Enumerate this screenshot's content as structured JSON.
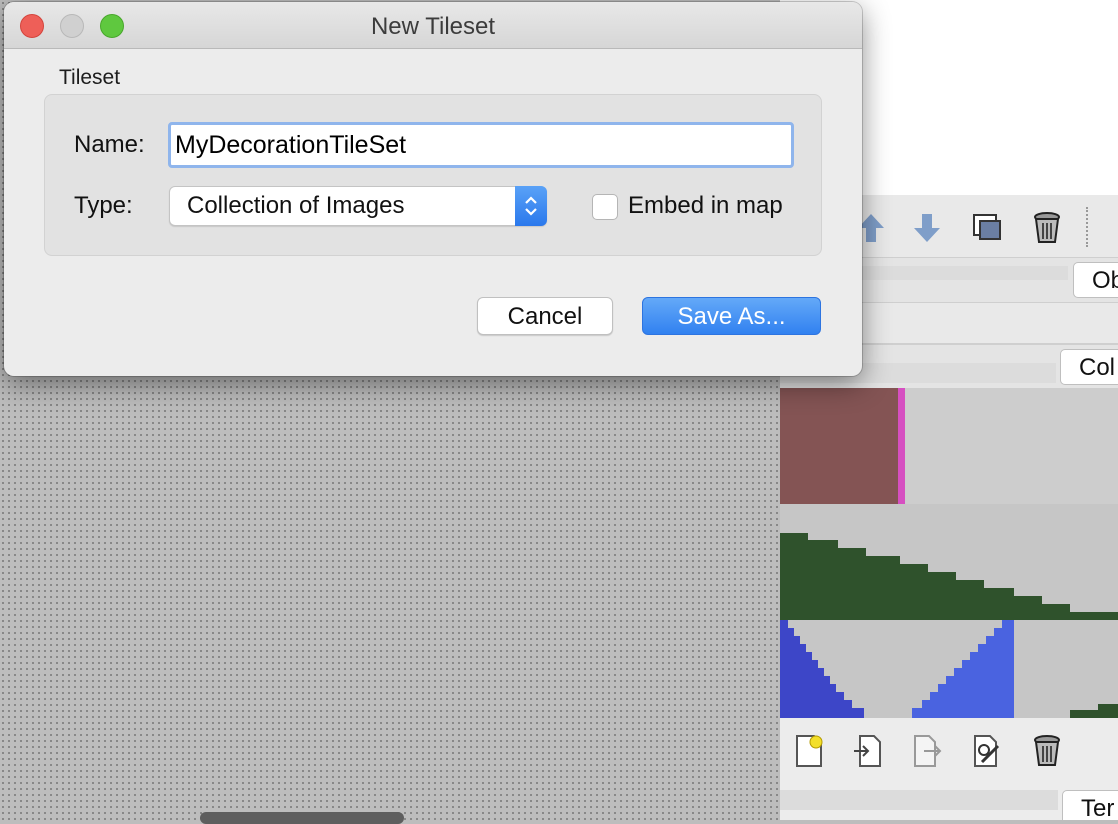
{
  "dialog": {
    "title": "New Tileset",
    "group_label": "Tileset",
    "name_label": "Name:",
    "name_value": "MyDecorationTileSet",
    "type_label": "Type:",
    "type_value": "Collection of Images",
    "embed_label": "Embed in map",
    "embed_checked": false,
    "cancel_label": "Cancel",
    "save_label": "Save As..."
  },
  "background_app": {
    "tab_objects": "Ob",
    "tab_collection": "Col",
    "tab_terrain": "Ter",
    "toolbar_top_icons": [
      "move-up-icon",
      "move-down-icon",
      "duplicate-icon",
      "trash-icon"
    ],
    "toolbar_bottom_icons": [
      "new-item-icon",
      "import-icon",
      "export-icon",
      "edit-icon",
      "trash-icon"
    ]
  },
  "colors": {
    "save_button": "#3181f0",
    "focus_ring": "#8fb5ec",
    "close": "#ee5f58",
    "zoom": "#5fc83f"
  }
}
